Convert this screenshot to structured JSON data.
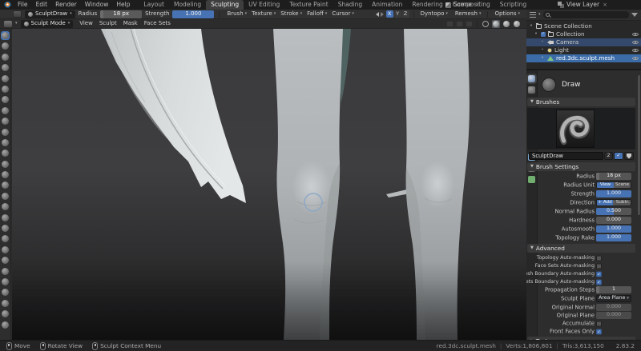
{
  "colors": {
    "accent": "#4772b3",
    "selected_row": "#3b6ca8",
    "viewport_top": "#3e3e40",
    "viewport_bottom": "#1c1c1d"
  },
  "glyphs": {
    "caret_down": "▾",
    "expanded": "▼",
    "collapsed": "►",
    "dot": "•",
    "close": "×"
  },
  "topbar": {
    "menus": [
      {
        "label": "File"
      },
      {
        "label": "Edit"
      },
      {
        "label": "Render"
      },
      {
        "label": "Window"
      },
      {
        "label": "Help"
      }
    ],
    "workspaces": [
      {
        "label": "Layout"
      },
      {
        "label": "Modeling"
      },
      {
        "label": "Sculpting",
        "active": true
      },
      {
        "label": "UV Editing"
      },
      {
        "label": "Texture Paint"
      },
      {
        "label": "Shading"
      },
      {
        "label": "Animation"
      },
      {
        "label": "Rendering"
      },
      {
        "label": "Compositing"
      },
      {
        "label": "Scripting"
      }
    ],
    "scene_label": "Scene",
    "view_layer_label": "View Layer"
  },
  "tool_header": {
    "brush_selector": "SculptDraw",
    "radius_label": "Radius",
    "radius_value": "18 px",
    "radius_fill": 0.08,
    "strength_label": "Strength",
    "strength_value": "1.000",
    "strength_fill": 1,
    "dropdowns": [
      {
        "label": "Brush"
      },
      {
        "label": "Texture"
      },
      {
        "label": "Stroke"
      },
      {
        "label": "Falloff"
      },
      {
        "label": "Cursor"
      }
    ],
    "mirror_axes": [
      {
        "label": "X",
        "active": true
      },
      {
        "label": "Y"
      },
      {
        "label": "Z"
      }
    ],
    "dyntopo_label": "Dyntopo",
    "remesh_label": "Remesh",
    "options_label": "Options"
  },
  "mode_header": {
    "mode_label": "Sculpt Mode",
    "menus": [
      {
        "label": "View"
      },
      {
        "label": "Sculpt"
      },
      {
        "label": "Mask"
      },
      {
        "label": "Face Sets"
      }
    ]
  },
  "toolbar": {
    "brushes": [
      {
        "name": "draw-brush-tool",
        "active": true
      },
      {
        "name": "draw-sharp-tool"
      },
      {
        "name": "clay-tool"
      },
      {
        "name": "clay-strips-tool"
      },
      {
        "name": "clay-thumb-tool"
      },
      {
        "name": "layer-tool"
      },
      {
        "name": "inflate-tool"
      },
      {
        "name": "blob-tool"
      },
      {
        "name": "crease-tool"
      },
      {
        "name": "smooth-tool"
      },
      {
        "name": "flatten-tool"
      },
      {
        "name": "fill-tool"
      },
      {
        "name": "scrape-tool"
      },
      {
        "name": "multiplane-scrape-tool"
      },
      {
        "name": "pinch-tool"
      },
      {
        "name": "grab-tool"
      },
      {
        "name": "elastic-deform-tool"
      },
      {
        "name": "snake-hook-tool"
      },
      {
        "name": "thumb-tool"
      },
      {
        "name": "pose-tool"
      },
      {
        "name": "nudge-tool"
      },
      {
        "name": "rotate-tool"
      },
      {
        "name": "slide-relax-tool"
      },
      {
        "name": "boundary-tool"
      },
      {
        "name": "cloth-tool"
      },
      {
        "name": "simplify-tool"
      },
      {
        "name": "mask-tool"
      },
      {
        "name": "draw-face-sets-tool"
      }
    ]
  },
  "outliner": {
    "rows": [
      {
        "label": "Scene Collection"
      },
      {
        "label": "Collection"
      },
      {
        "label": "Camera"
      },
      {
        "label": "Light"
      },
      {
        "label": "red.3dc.sculpt.mesh"
      }
    ]
  },
  "properties": {
    "tabs": [
      {
        "name": "active-tool-tab",
        "active": true
      },
      {
        "name": "render-tab"
      },
      {
        "name": "output-tab"
      },
      {
        "name": "view-layer-tab"
      },
      {
        "name": "scene-tab"
      },
      {
        "name": "world-tab"
      },
      {
        "name": "object-tab",
        "tint": "#c77f3e"
      },
      {
        "name": "modifiers-tab",
        "tint": "#7aa5d0"
      },
      {
        "name": "physics-tab"
      },
      {
        "name": "object-data-tab",
        "tint": "#6fae6f"
      }
    ],
    "tool_name": "Draw",
    "brushes_header": "Brushes",
    "brush_name": "SculptDraw",
    "brush_users": "2",
    "brush_settings": {
      "header": "Brush Settings",
      "radius_label": "Radius",
      "radius_value": "18 px",
      "radius_fill": 0.08,
      "radius_unit_label": "Radius Unit",
      "radius_unit": [
        {
          "label": "View",
          "on": true
        },
        {
          "label": "Scene"
        }
      ],
      "strength_label": "Strength",
      "strength_value": "1.000",
      "strength_fill": 1,
      "direction_label": "Direction",
      "direction": [
        {
          "label": "+ Add",
          "on": true
        },
        {
          "label": "- Subtr.."
        }
      ],
      "normal_radius_label": "Normal Radius",
      "normal_radius_value": "0.500",
      "normal_radius_fill": 0.5,
      "hardness_label": "Hardness",
      "hardness_value": "0.000",
      "hardness_fill": 0,
      "autosmooth_label": "Autosmooth",
      "autosmooth_value": "1.000",
      "autosmooth_fill": 1,
      "topology_rake_label": "Topology Rake",
      "topology_rake_value": "1.000",
      "topology_rake_fill": 1
    },
    "advanced": {
      "header": "Advanced",
      "automasking": [
        {
          "label": "Topology Auto-masking",
          "checked": false
        },
        {
          "label": "Face Sets Auto-masking",
          "checked": false
        },
        {
          "label": "Mesh Boundary Auto-masking",
          "checked": true
        },
        {
          "label": "Face Sets Boundary Auto-masking",
          "checked": true
        }
      ],
      "propagation_label": "Propagation Steps",
      "propagation_value": "1",
      "propagation_fill": 0.1,
      "sculpt_plane_label": "Sculpt Plane",
      "sculpt_plane_value": "Area Plane",
      "original_normal_label": "Original Normal",
      "original_normal_value": "0.000",
      "original_plane_label": "Original Plane",
      "original_plane_value": "0.000",
      "accumulate_label": "Accumulate",
      "accumulate_checked": false,
      "front_faces_label": "Front Faces Only",
      "front_faces_checked": true
    },
    "texture_header": "Texture"
  },
  "statusbar": {
    "hints": [
      {
        "label": "Move",
        "icon": "mouse-left-icon"
      },
      {
        "label": "Rotate View",
        "icon": "mouse-middle-icon",
        "mid": true
      },
      {
        "label": "Sculpt Context Menu",
        "icon": "mouse-right-icon",
        "rgt": true
      }
    ],
    "object_name": "red.3dc.sculpt.mesh",
    "verts": "Verts:1,806,801",
    "tris": "Tris:3,613,150",
    "version": "2.83.2"
  }
}
